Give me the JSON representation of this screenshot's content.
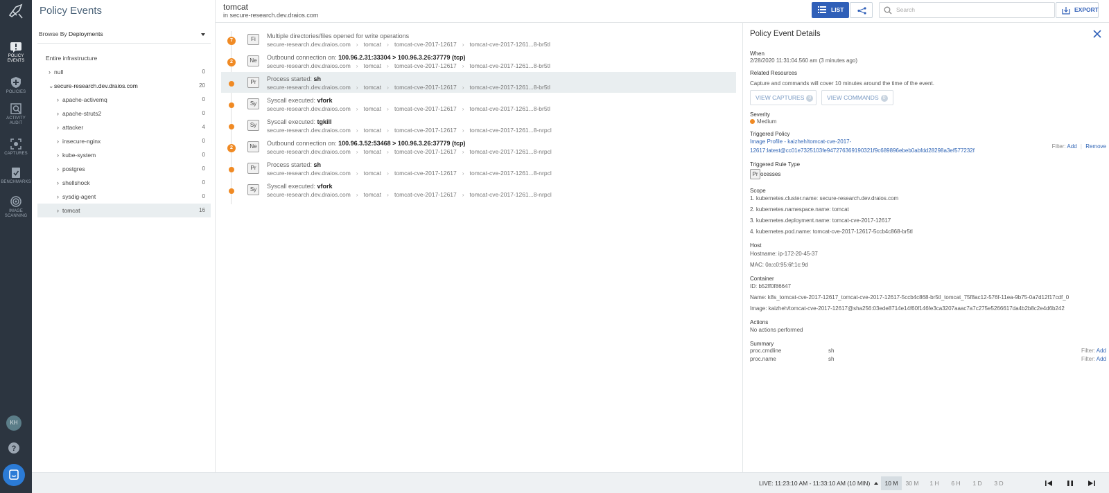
{
  "nav": {
    "items": [
      {
        "label": "POLICY EVENTS",
        "icon": "policy-events-icon",
        "active": true
      },
      {
        "label": "POLICIES",
        "icon": "shield-plus-icon",
        "active": false
      },
      {
        "label": "ACTIVITY AUDIT",
        "icon": "activity-audit-icon",
        "active": false
      },
      {
        "label": "CAPTURES",
        "icon": "captures-icon",
        "active": false
      },
      {
        "label": "BENCHMARKS",
        "icon": "benchmarks-icon",
        "active": false
      },
      {
        "label": "IMAGE SCANNING",
        "icon": "image-scanning-icon",
        "active": false
      }
    ],
    "avatar": "KH"
  },
  "left": {
    "title": "Policy Events",
    "browse_prefix": "Browse By",
    "browse_value": "Deployments",
    "tree": [
      {
        "label": "Entire infrastructure",
        "count": "",
        "level": 0,
        "chevron": "",
        "selected": false
      },
      {
        "label": "null",
        "count": "0",
        "level": 1,
        "chevron": "›",
        "selected": false
      },
      {
        "label": "secure-research.dev.draios.com",
        "count": "20",
        "level": 1,
        "chevron": "⌄",
        "selected": false
      },
      {
        "label": "apache-activemq",
        "count": "0",
        "level": 2,
        "chevron": "›",
        "selected": false
      },
      {
        "label": "apache-struts2",
        "count": "0",
        "level": 2,
        "chevron": "›",
        "selected": false
      },
      {
        "label": "attacker",
        "count": "4",
        "level": 2,
        "chevron": "›",
        "selected": false
      },
      {
        "label": "insecure-nginx",
        "count": "0",
        "level": 2,
        "chevron": "›",
        "selected": false
      },
      {
        "label": "kube-system",
        "count": "0",
        "level": 2,
        "chevron": "›",
        "selected": false
      },
      {
        "label": "postgres",
        "count": "0",
        "level": 2,
        "chevron": "›",
        "selected": false
      },
      {
        "label": "shellshock",
        "count": "0",
        "level": 2,
        "chevron": "›",
        "selected": false
      },
      {
        "label": "sysdig-agent",
        "count": "0",
        "level": 2,
        "chevron": "›",
        "selected": false
      },
      {
        "label": "tomcat",
        "count": "16",
        "level": 2,
        "chevron": "›",
        "selected": true
      }
    ]
  },
  "header": {
    "title": "tomcat",
    "subtitle": "in secure-research.dev.draios.com",
    "list_label": "LIST",
    "search_placeholder": "Search",
    "export_label": "EXPORT"
  },
  "events": [
    {
      "count": "7",
      "type": "Fi",
      "title": "Multiple directories/files opened for write operations",
      "value": "",
      "crumbs": [
        "secure-research.dev.draios.com",
        "tomcat",
        "tomcat-cve-2017-12617",
        "tomcat-cve-2017-1261...8-br5tl"
      ],
      "selected": false
    },
    {
      "count": "2",
      "type": "Ne",
      "title": "Outbound connection on: ",
      "value": "100.96.2.31:33304 > 100.96.3.26:37779 (tcp)",
      "crumbs": [
        "secure-research.dev.draios.com",
        "tomcat",
        "tomcat-cve-2017-12617",
        "tomcat-cve-2017-1261...8-br5tl"
      ],
      "selected": false
    },
    {
      "count": "",
      "type": "Pr",
      "title": "Process started: ",
      "value": "sh",
      "crumbs": [
        "secure-research.dev.draios.com",
        "tomcat",
        "tomcat-cve-2017-12617",
        "tomcat-cve-2017-1261...8-br5tl"
      ],
      "selected": true
    },
    {
      "count": "",
      "type": "Sy",
      "title": "Syscall executed: ",
      "value": "vfork",
      "crumbs": [
        "secure-research.dev.draios.com",
        "tomcat",
        "tomcat-cve-2017-12617",
        "tomcat-cve-2017-1261...8-br5tl"
      ],
      "selected": false
    },
    {
      "count": "",
      "type": "Sy",
      "title": "Syscall executed: ",
      "value": "tgkill",
      "crumbs": [
        "secure-research.dev.draios.com",
        "tomcat",
        "tomcat-cve-2017-12617",
        "tomcat-cve-2017-1261...8-nrpcl"
      ],
      "selected": false
    },
    {
      "count": "2",
      "type": "Ne",
      "title": "Outbound connection on: ",
      "value": "100.96.3.52:53468 > 100.96.3.26:37779 (tcp)",
      "crumbs": [
        "secure-research.dev.draios.com",
        "tomcat",
        "tomcat-cve-2017-12617",
        "tomcat-cve-2017-1261...8-nrpcl"
      ],
      "selected": false
    },
    {
      "count": "",
      "type": "Pr",
      "title": "Process started: ",
      "value": "sh",
      "crumbs": [
        "secure-research.dev.draios.com",
        "tomcat",
        "tomcat-cve-2017-12617",
        "tomcat-cve-2017-1261...8-nrpcl"
      ],
      "selected": false
    },
    {
      "count": "",
      "type": "Sy",
      "title": "Syscall executed: ",
      "value": "vfork",
      "crumbs": [
        "secure-research.dev.draios.com",
        "tomcat",
        "tomcat-cve-2017-12617",
        "tomcat-cve-2017-1261...8-nrpcl"
      ],
      "selected": false
    }
  ],
  "details": {
    "title": "Policy Event Details",
    "when_label": "When",
    "when_value": "2/28/2020 11:31:04.560 am (3 minutes ago)",
    "related_label": "Related Resources",
    "related_note": "Capture and commands will cover 10 minutes around the time of the event.",
    "view_captures": "VIEW CAPTURES",
    "captures_count": "0",
    "view_commands": "VIEW COMMANDS",
    "commands_count": "0",
    "severity_label": "Severity",
    "severity_value": "Medium",
    "policy_label": "Triggered Policy",
    "policy_line1": "Image Profile - kaizheh/tomcat-cve-2017-",
    "policy_line2": "12617:latest@cc01e7325103fe947276369190321f9c689896ebeb0abfdd28298a3ef577232f",
    "filter_label": "Filter:",
    "add_label": "Add",
    "remove_label": "Remove",
    "rule_type_label": "Triggered Rule Type",
    "rule_type_badge": "Pr",
    "rule_type_value": "ocesses",
    "scope_label": "Scope",
    "scope": [
      "1. kubernetes.cluster.name: secure-research.dev.draios.com",
      "2. kubernetes.namespace.name: tomcat",
      "3. kubernetes.deployment.name: tomcat-cve-2017-12617",
      "4. kubernetes.pod.name: tomcat-cve-2017-12617-5ccb4c868-br5tl"
    ],
    "host_label": "Host",
    "hostname": "Hostname: ip-172-20-45-37",
    "mac": "MAC: 0a:c0:95:6f:1c:9d",
    "container_label": "Container",
    "container_id": "ID: b52ff0f86647",
    "container_name": "Name: k8s_tomcat-cve-2017-12617_tomcat-cve-2017-12617-5ccb4c868-br5tl_tomcat_75f8ac12-576f-11ea-9b75-0a7d12f17cdf_0",
    "container_image": "Image: kaizheh/tomcat-cve-2017-12617@sha256:03ede8714e14f60f146fe3ca3207aaac7a7c275e5266617da4b2b8c2e4d6b242",
    "actions_label": "Actions",
    "actions_value": "No actions performed",
    "summary_label": "Summary",
    "summary": [
      {
        "key": "proc.cmdline",
        "value": "sh"
      },
      {
        "key": "proc.name",
        "value": "sh"
      }
    ]
  },
  "bottom": {
    "live": "LIVE: 11:23:10 AM - 11:33:10 AM (10 MIN)",
    "ranges": [
      "10 M",
      "30 M",
      "1 H",
      "6 H",
      "1 D",
      "3 D"
    ],
    "active_range": "10 M"
  },
  "colors": {
    "nav_bg": "#2c3540",
    "accent": "#2f5fb8",
    "severity_medium": "#f08a24",
    "selected_row": "#e9eef0"
  }
}
